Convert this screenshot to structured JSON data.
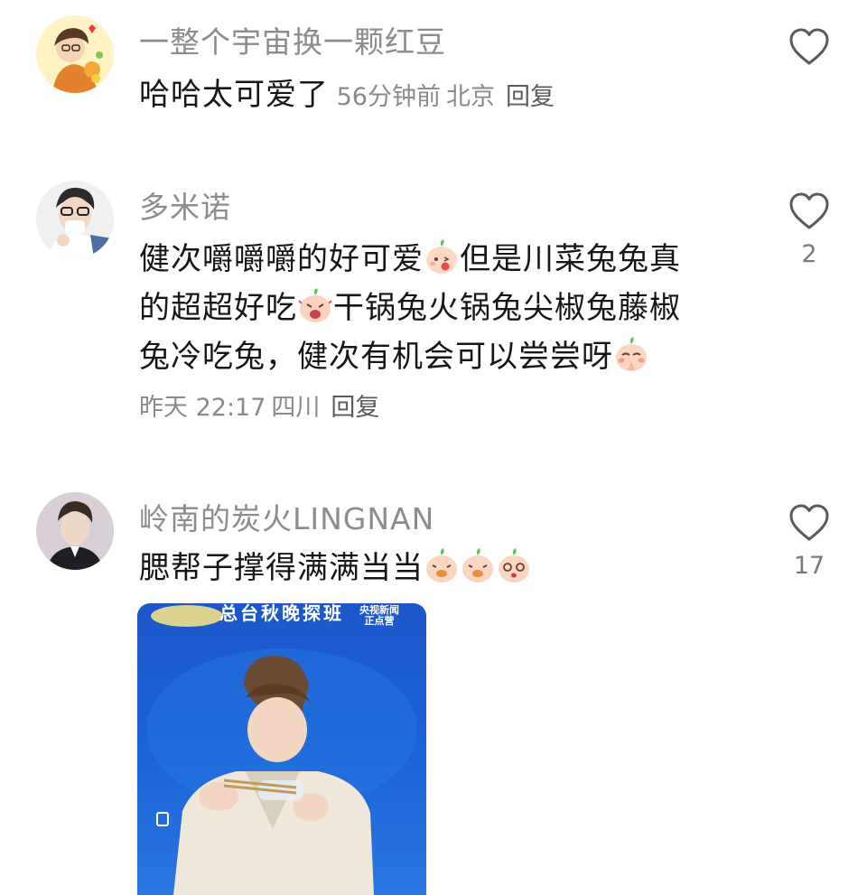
{
  "comments": [
    {
      "username": "一整个宇宙换一颗红豆",
      "text": "哈哈太可爱了",
      "time": "56分钟前",
      "location": "北京",
      "reply_label": "回复",
      "like_count": "",
      "avatar_icon": "avatar-cartoon-boy"
    },
    {
      "username": "多米诺",
      "text_parts": [
        "健次嚼嚼嚼的好可爱",
        "但是川菜兔兔真的超超好吃",
        "干锅兔火锅兔尖椒兔藤椒兔冷吃兔，健次有机会可以尝尝呀"
      ],
      "text_lines": [
        "健次嚼嚼嚼的好可爱",
        "但是川菜兔兔真",
        "的超超好吃",
        "干锅兔火锅兔尖椒兔藤椒",
        "兔冷吃兔，健次有机会可以尝尝呀"
      ],
      "time": "昨天 22:17",
      "location": "四川",
      "reply_label": "回复",
      "like_count": "2",
      "avatar_icon": "avatar-man-glasses"
    },
    {
      "username": "岭南的炭火LINGNAN",
      "text": "腮帮子撑得满满当当",
      "like_count": "17",
      "avatar_icon": "avatar-man-portrait",
      "image": {
        "banner_text": "总台秋晚探班",
        "badge_line1": "央视新闻",
        "badge_line2": "正点营"
      }
    }
  ],
  "colors": {
    "username": "#8c8c8c",
    "text": "#161616",
    "meta": "#8a8a8a",
    "photo_bg": "#1a62d6"
  },
  "icons": {
    "like": "heart-outline-icon",
    "emoji": "peach-bun-emoji"
  }
}
